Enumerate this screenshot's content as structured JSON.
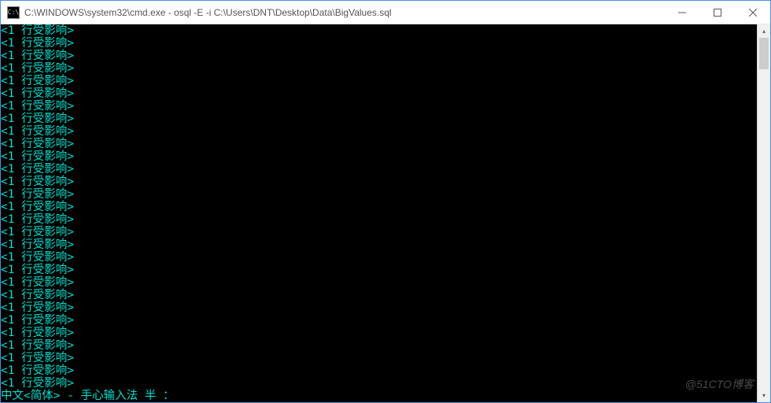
{
  "window": {
    "icon_label": "C:\\",
    "title": "C:\\WINDOWS\\system32\\cmd.exe - osql  -E -i C:\\Users\\DNT\\Desktop\\Data\\BigValues.sql"
  },
  "console": {
    "repeated_line": "<1 行受影响>",
    "repeat_count": 29,
    "status_line": "中文<简体> - 手心输入法 半 ："
  },
  "watermark": "@51CTO博客",
  "colors": {
    "console_bg": "#000000",
    "console_fg": "#00e0d0",
    "titlebar_text": "#555555",
    "border": "#4a90d9"
  }
}
